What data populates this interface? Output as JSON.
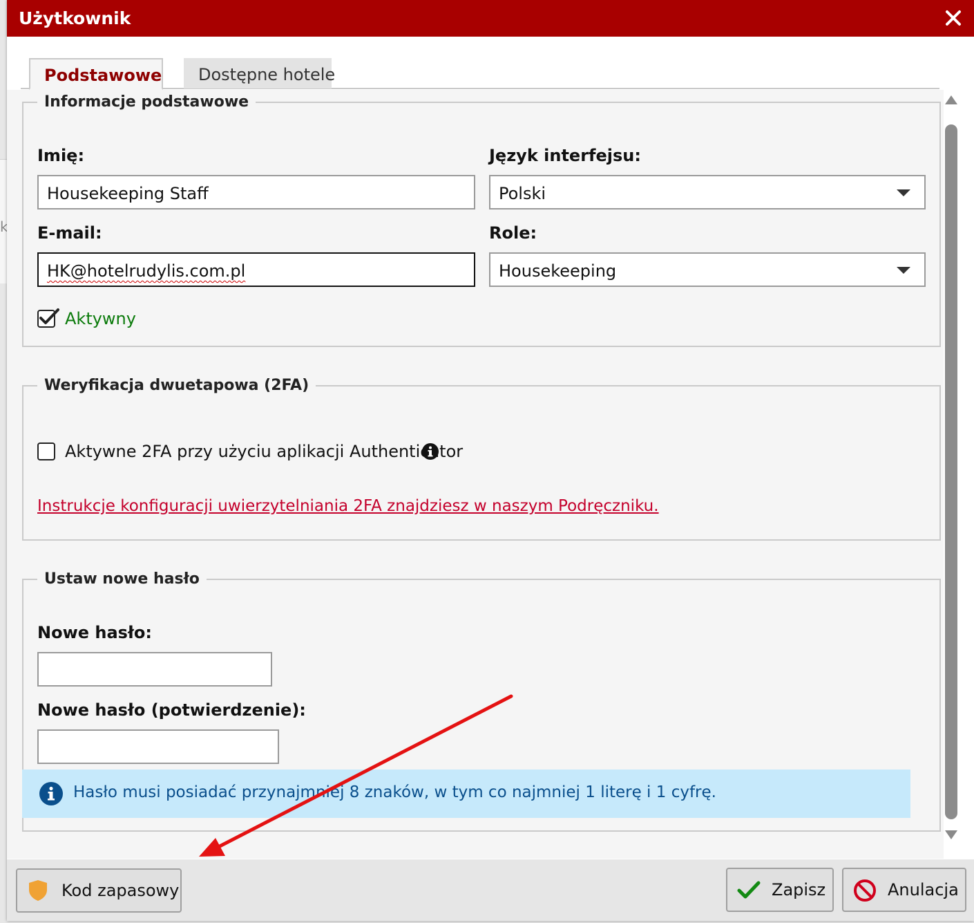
{
  "dialog": {
    "title": "Użytkownik"
  },
  "tabs": [
    {
      "label": "Podstawowe",
      "active": true
    },
    {
      "label": "Dostępne hotele",
      "active": false
    }
  ],
  "basic_info": {
    "legend": "Informacje podstawowe",
    "name_label": "Imię:",
    "name_value": "Housekeeping Staff",
    "language_label": "Język interfejsu:",
    "language_value": "Polski",
    "email_label": "E-mail:",
    "email_value": "HK@hotelrudylis.com.pl",
    "role_label": "Role:",
    "role_value": "Housekeeping",
    "active_label": "Aktywny",
    "active_checked": true
  },
  "twofa": {
    "legend": "Weryfikacja dwuetapowa (2FA)",
    "checkbox_label": "Aktywne 2FA przy użyciu aplikacji Authenticator",
    "checkbox_checked": false,
    "link_text": "Instrukcje konfiguracji uwierzytelniania 2FA znajdziesz w naszym Podręczniku."
  },
  "password": {
    "legend": "Ustaw nowe hasło",
    "new_label": "Nowe hasło:",
    "new_value": "",
    "confirm_label": "Nowe hasło (potwierdzenie):",
    "confirm_value": "",
    "info": "Hasło musi posiadać przynajmniej 8 znaków, w tym co najmniej 1 literę i 1 cyfrę."
  },
  "footer": {
    "backup_code_label": "Kod zapasowy",
    "save_label": "Zapisz",
    "cancel_label": "Anulacja"
  },
  "colors": {
    "titlebar": "#a80000",
    "active_tab_text": "#8e0000",
    "active_label": "#0a7a0a",
    "link": "#c4002b",
    "info_bg": "#c6e9fb",
    "annotation_arrow": "#e41212"
  },
  "icons": [
    "close-icon",
    "chevron-down-icon",
    "checkmark-icon",
    "info-icon",
    "shield-icon",
    "check-icon",
    "cancel-icon",
    "annotation-arrow"
  ]
}
